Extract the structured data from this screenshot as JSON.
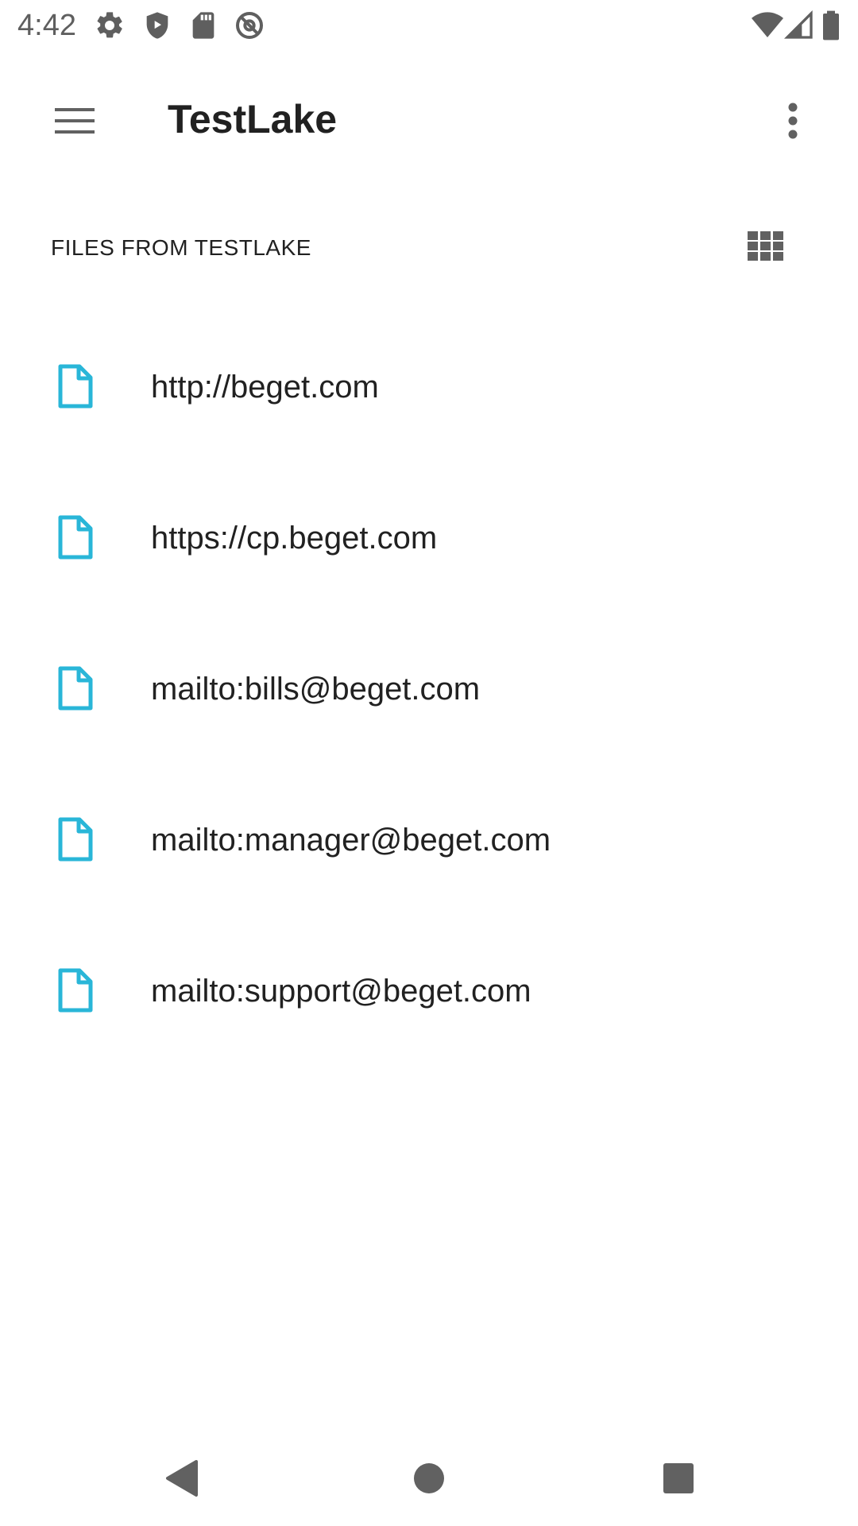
{
  "status_bar": {
    "time": "4:42",
    "icons": [
      "gear-icon",
      "shield-play-icon",
      "sd-card-icon",
      "at-sign-icon",
      "wifi-icon",
      "cell-signal-icon",
      "battery-icon"
    ]
  },
  "app_bar": {
    "title": "TestLake",
    "menu_icon": "hamburger-menu-icon",
    "overflow_icon": "more-vertical-icon"
  },
  "section": {
    "header": "FILES FROM TESTLAKE",
    "view_toggle_icon": "grid-view-icon"
  },
  "files": [
    {
      "name": "http://beget.com",
      "icon": "file-icon"
    },
    {
      "name": "https://cp.beget.com",
      "icon": "file-icon"
    },
    {
      "name": "mailto:bills@beget.com",
      "icon": "file-icon"
    },
    {
      "name": "mailto:manager@beget.com",
      "icon": "file-icon"
    },
    {
      "name": "mailto:support@beget.com",
      "icon": "file-icon"
    }
  ],
  "nav_bar": {
    "icons": [
      "back-icon",
      "home-icon",
      "recents-icon"
    ]
  },
  "colors": {
    "file_icon": "#29b6d8",
    "text_primary": "#212121",
    "icon_gray": "#616161",
    "status_gray": "#5f5f5f"
  }
}
